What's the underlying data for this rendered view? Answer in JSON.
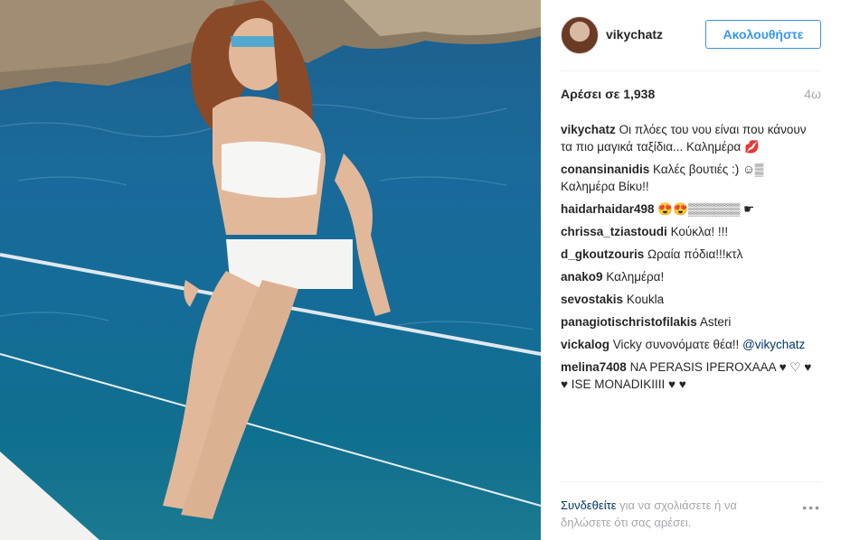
{
  "post": {
    "username": "vikychatz",
    "follow_label": "Ακολουθήστε",
    "likes_text": "Αρέσει σε 1,938",
    "time_ago": "4ω"
  },
  "comments": [
    {
      "user": "vikychatz",
      "text": "Οι πλόες του νου είναι που κάνουν τα πιο μαγικά ταξίδια... Καλημέρα 💋"
    },
    {
      "user": "conansinanidis",
      "text": "Καλές βουτιές :) ☺︎▒ Καλημέρα Βίκυ!!"
    },
    {
      "user": "haidarhaidar498",
      "text": "😍😍▒▒▒▒▒▒ ☛"
    },
    {
      "user": "chrissa_tziastoudi",
      "text": "Κούκλα! !!!"
    },
    {
      "user": "d_gkoutzouris",
      "text": "Ωραία πόδια!!!κτλ"
    },
    {
      "user": "anako9",
      "text": "Καλημέρα!"
    },
    {
      "user": "sevostakis",
      "text": "Koukla"
    },
    {
      "user": "panagiotischristofilakis",
      "text": "Asteri"
    },
    {
      "user": "vickalog",
      "text": "Vicky συνονόματε θέα!!",
      "mention": "@vikychatz"
    },
    {
      "user": "melina7408",
      "text": "NA PERASIS IPEROXAAA ♥ ♡ ♥ ♥ ISE MONADIKIIII ♥ ♥"
    }
  ],
  "footer": {
    "login_link": "Συνδεθείτε",
    "login_rest": " για να σχολιάσετε ή να δηλώσετε ότι σας αρέσει.",
    "more_label": "•••"
  },
  "icons": {
    "more": "more-options-icon",
    "avatar": "avatar"
  },
  "colors": {
    "link": "#3897f0",
    "username": "#262626",
    "muted": "#a5a7aa",
    "mention": "#003569"
  }
}
